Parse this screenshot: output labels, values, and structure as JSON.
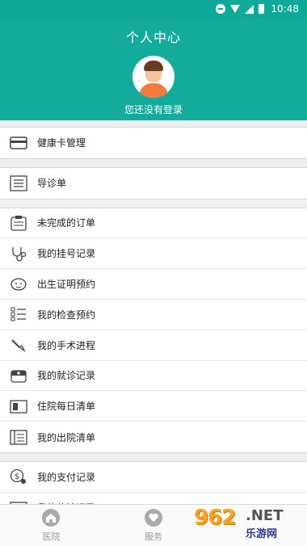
{
  "status_bar": {
    "time": "10:48"
  },
  "header": {
    "title": "个人中心",
    "login_prompt": "您还没有登录"
  },
  "groups": [
    {
      "items": [
        {
          "label": "健康卡管理",
          "icon": "card-icon"
        }
      ]
    },
    {
      "items": [
        {
          "label": "导诊单",
          "icon": "list-icon"
        }
      ]
    },
    {
      "items": [
        {
          "label": "未完成的订单",
          "icon": "clipboard-icon"
        },
        {
          "label": "我的挂号记录",
          "icon": "stethoscope-icon"
        },
        {
          "label": "出生证明预约",
          "icon": "baby-icon"
        },
        {
          "label": "我的检查预约",
          "icon": "checklist-icon"
        },
        {
          "label": "我的手术进程",
          "icon": "scalpel-icon"
        },
        {
          "label": "我的就诊记录",
          "icon": "medical-box-icon"
        },
        {
          "label": "住院每日清单",
          "icon": "hospital-list-icon"
        },
        {
          "label": "我的出院清单",
          "icon": "discharge-list-icon"
        }
      ]
    },
    {
      "items": [
        {
          "label": "我的支付记录",
          "icon": "payment-icon"
        },
        {
          "label": "我的停诊记录",
          "icon": "news-icon"
        }
      ]
    }
  ],
  "tabbar": {
    "tabs": [
      {
        "label": "医院",
        "icon": "home-icon"
      },
      {
        "label": "服务",
        "icon": "heart-icon"
      },
      {
        "label": "",
        "icon": ""
      }
    ]
  },
  "watermark": {
    "logo": "962",
    "suffix": ".NET",
    "subtitle": "乐游网"
  }
}
